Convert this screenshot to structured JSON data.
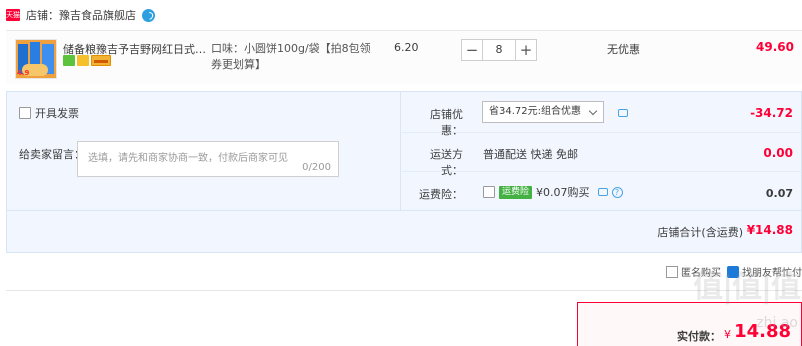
{
  "store": {
    "badge": "天猫",
    "label": "店铺：",
    "name": "豫吉食品旗舰店"
  },
  "item": {
    "thumb_price": "4.9",
    "title": "储备粮豫吉予吉野网红日式小圆饼干",
    "sku": "口味：小圆饼100g/袋【拍8包领券更划算】",
    "unit_price": "6.20",
    "quantity": "8",
    "minus_label": "−",
    "plus_label": "+",
    "promo": "无优惠",
    "subtotal": "49.60"
  },
  "invoice": {
    "label": "开具发票"
  },
  "message": {
    "label": "给卖家留言：",
    "placeholder": "选填，请先和商家协商一致，付款后商家可见",
    "counter": "0/200"
  },
  "shop_discount": {
    "label": "店铺优惠：",
    "selected": "省34.72元:组合优惠",
    "amount": "-34.72"
  },
  "shipping": {
    "label": "运送方式：",
    "method": "普通配送 快递 免邮",
    "amount": "0.00"
  },
  "insurance": {
    "label": "运费险：",
    "tag": "运费险",
    "desc": "¥0.07购买",
    "amount": "0.07"
  },
  "shop_total": {
    "label": "店铺合计(含运费)",
    "amount": "¥14.88"
  },
  "pay_options": {
    "anonymous": "匿名购买",
    "friend": "找朋友帮忙付"
  },
  "final": {
    "label": "实付款：",
    "currency": "¥",
    "amount": "14.88"
  },
  "watermark": {
    "main": "值|值|值",
    "sub": "zhi  ao"
  },
  "colors": {
    "accent": "#ff0036",
    "panel_bg": "#f2f7ff",
    "link_blue": "#4aa3e6"
  }
}
